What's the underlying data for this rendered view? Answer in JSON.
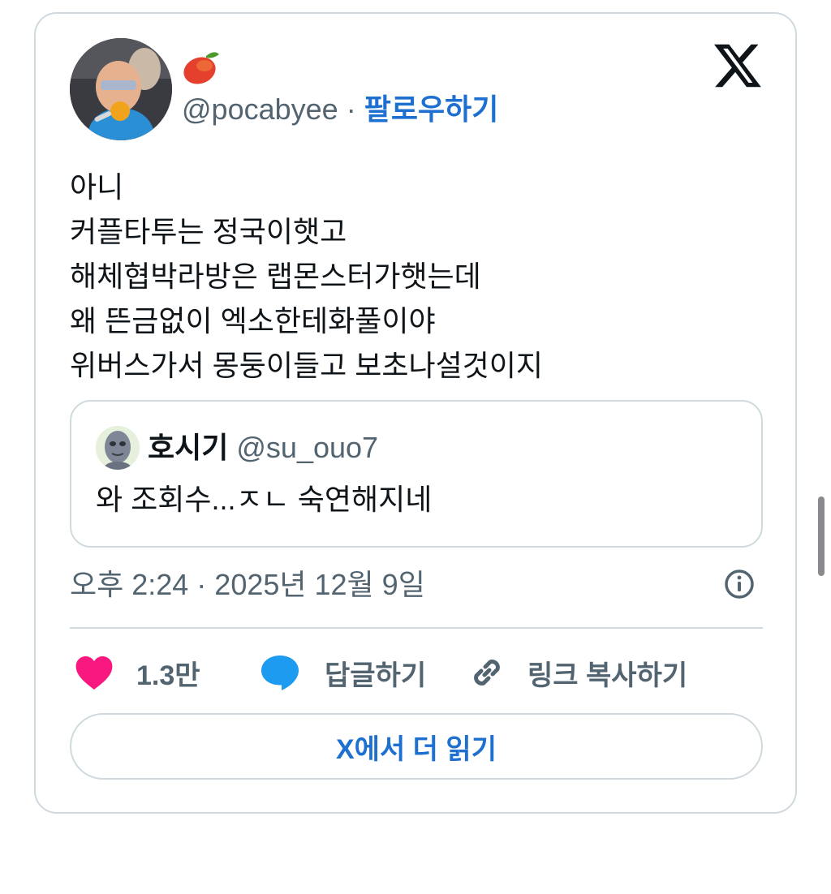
{
  "tweet": {
    "display_name_icon": "mango-emoji",
    "handle": "@pocabyee",
    "separator": "·",
    "follow_label": "팔로우하기",
    "text_lines": [
      "아니",
      "커플타투는 정국이햇고",
      "해체협박라방은 랩몬스터가햇는데",
      "왜 뜬금없이 엑소한테화풀이야",
      "위버스가서 몽둥이들고 보초나설것이지"
    ],
    "timestamp": "오후 2:24 · 2025년 12월 9일"
  },
  "quote": {
    "name": "호시기",
    "handle": "@su_ouo7",
    "text": "와 조회수...ㅈㄴ 숙연해지네"
  },
  "actions": {
    "like_count": "1.3만",
    "reply_label": "답글하기",
    "copy_link_label": "링크 복사하기"
  },
  "read_more_label": "X에서 더 읽기",
  "colors": {
    "accent": "#1d6fd0",
    "like": "#f91880",
    "reply": "#1d9bf0",
    "secondary_text": "#536471",
    "border": "#cfd9de"
  }
}
